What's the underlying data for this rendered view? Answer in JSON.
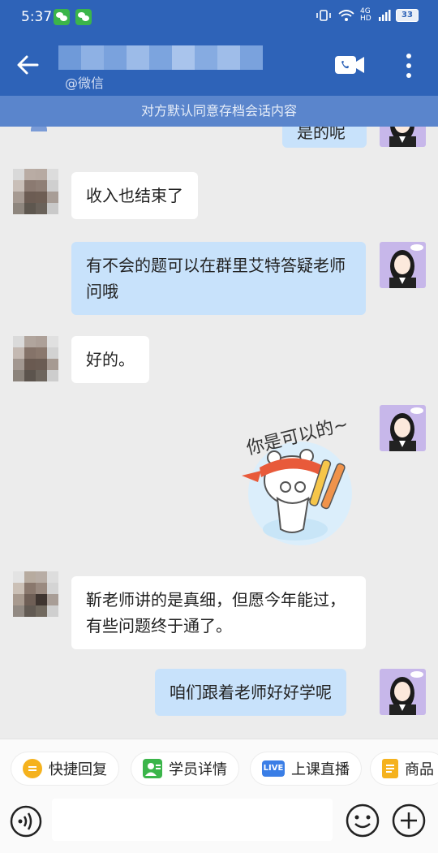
{
  "status_bar": {
    "time": "5:37",
    "network": "4G",
    "hd": "HD",
    "battery": "33"
  },
  "header": {
    "subtitle": "@微信"
  },
  "notice": "对方默认同意存档会话内容",
  "messages": [
    {
      "side": "right",
      "text": "是的呢"
    },
    {
      "side": "left",
      "text": "收入也结束了"
    },
    {
      "side": "right",
      "text": "有不会的题可以在群里艾特答疑老师问哦"
    },
    {
      "side": "left",
      "text": "好的。"
    },
    {
      "side": "right",
      "type": "sticker",
      "text": "你是可以的~"
    },
    {
      "side": "left",
      "text": "靳老师讲的是真细，但愿今年能过，有些问题终于通了。"
    },
    {
      "side": "right",
      "text": "咱们跟着老师好好学呢"
    }
  ],
  "quick_actions": [
    {
      "label": "快捷回复",
      "color": "#f5b21d"
    },
    {
      "label": "学员详情",
      "color": "#3bb54a"
    },
    {
      "label": "上课直播",
      "color": "#3a7ee6",
      "badge": "LIVE"
    },
    {
      "label": "商品",
      "color": "#f5b21d"
    }
  ],
  "colors": {
    "header": "#2e63b8",
    "notice": "#5a85cc",
    "bubble_out": "#c8e2fb",
    "bubble_in": "#ffffff"
  },
  "icons": [
    "back-arrow-icon",
    "video-call-icon",
    "more-vertical-icon",
    "voice-icon",
    "emoji-icon",
    "plus-icon"
  ]
}
